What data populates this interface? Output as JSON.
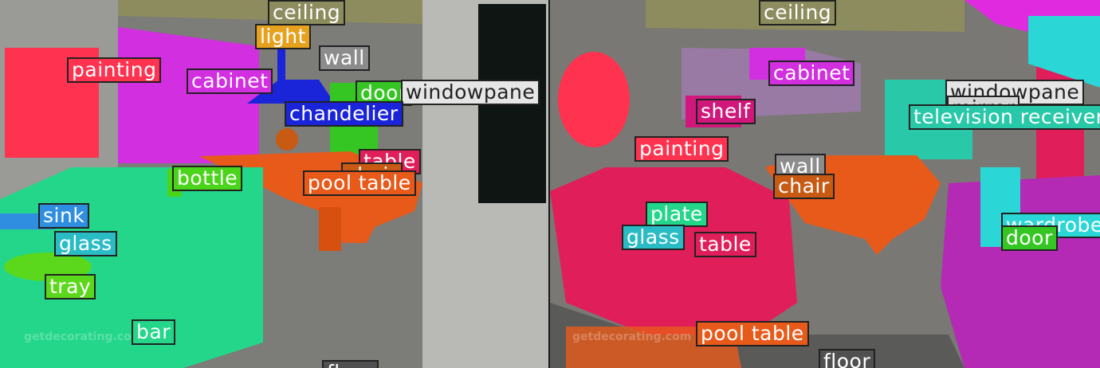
{
  "left": {
    "labels": [
      {
        "text": "ceiling",
        "color": "#8c8c5e"
      },
      {
        "text": "light",
        "color": "#e6a21e"
      },
      {
        "text": "wall",
        "color": "#8c8c8c"
      },
      {
        "text": "painting",
        "color": "#ff3250"
      },
      {
        "text": "cabinet",
        "color": "#d12fe0"
      },
      {
        "text": "door",
        "color": "#36c624"
      },
      {
        "text": "windowpane",
        "color": "#e6e6e6"
      },
      {
        "text": "chandelier",
        "color": "#1a24d8"
      },
      {
        "text": "table",
        "color": "#e01f5a"
      },
      {
        "text": "chair",
        "color": "#c85a14"
      },
      {
        "text": "pool table",
        "color": "#e85a1a"
      },
      {
        "text": "bottle",
        "color": "#4ad41a"
      },
      {
        "text": "sink",
        "color": "#2f8ee0"
      },
      {
        "text": "glass",
        "color": "#2abcc4"
      },
      {
        "text": "tray",
        "color": "#5cd81c"
      },
      {
        "text": "bar",
        "color": "#23d68a"
      },
      {
        "text": "floor",
        "color": "#505050"
      }
    ]
  },
  "right": {
    "labels": [
      {
        "text": "ceiling",
        "color": "#8c8c5e"
      },
      {
        "text": "cabinet",
        "color": "#d12fe0"
      },
      {
        "text": "windowpane",
        "color": "#e6e6e6"
      },
      {
        "text": "mirror",
        "color": "#d8d8d8"
      },
      {
        "text": "television receiver",
        "color": "#28c8a8"
      },
      {
        "text": "shelf",
        "color": "#d0187c"
      },
      {
        "text": "painting",
        "color": "#ff3250"
      },
      {
        "text": "wall",
        "color": "#8c8c8c"
      },
      {
        "text": "chair",
        "color": "#c85a14"
      },
      {
        "text": "plate",
        "color": "#23d68a"
      },
      {
        "text": "glass",
        "color": "#2abcc4"
      },
      {
        "text": "table",
        "color": "#e01f5a"
      },
      {
        "text": "wardrobe",
        "color": "#2ad6d6"
      },
      {
        "text": "door",
        "color": "#36c624"
      },
      {
        "text": "pool table",
        "color": "#e85a1a"
      },
      {
        "text": "floor",
        "color": "#505050"
      }
    ]
  },
  "watermark": "getdecorating.com"
}
